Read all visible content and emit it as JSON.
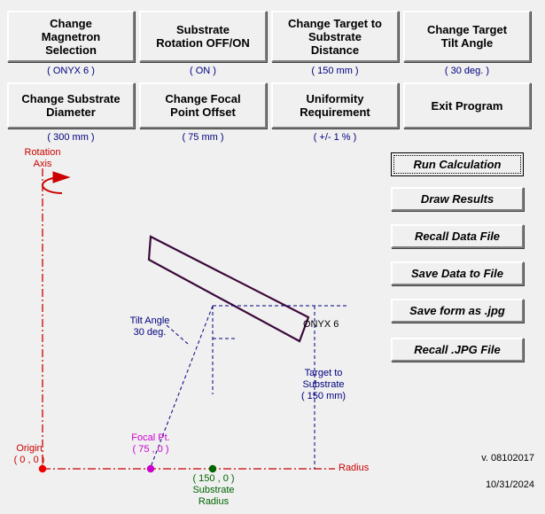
{
  "app": {
    "background_color": "#f0f0f0",
    "version_text": "v. 08102017",
    "date_text": "10/31/2024"
  },
  "setting_buttons": [
    {
      "label": "Change\nMagnetron\nSelection",
      "value": "( ONYX 6 )"
    },
    {
      "label": "Substrate\nRotation OFF/ON",
      "value": "( ON )"
    },
    {
      "label": "Change Target to\nSubstrate\nDistance",
      "value": "( 150 mm )"
    },
    {
      "label": "Change Target\nTilt Angle",
      "value": "( 30 deg. )"
    },
    {
      "label": "Change Substrate\nDiameter",
      "value": "( 300 mm )"
    },
    {
      "label": "Change Focal\nPoint Offset",
      "value": "( 75 mm )"
    },
    {
      "label": "Uniformity\nRequirement",
      "value": "( +/- 1 % )"
    },
    {
      "label": "Exit Program",
      "value": ""
    }
  ],
  "action_buttons": [
    {
      "label": "Run Calculation",
      "focused": true
    },
    {
      "label": "Draw Results",
      "focused": false
    },
    {
      "label": "Recall Data File",
      "focused": false
    },
    {
      "label": "Save Data to File",
      "focused": false
    },
    {
      "label": "Save form as .jpg",
      "focused": false
    },
    {
      "label": "Recall .JPG File",
      "focused": false
    }
  ],
  "diagram": {
    "rotation_axis_label": "Rotation\nAxis",
    "tilt_angle_label": "Tilt Angle\n30 deg.",
    "magnetron_label": "ONYX 6",
    "target_to_substrate_label": "Target to\nSubstrate\n( 150 mm)",
    "origin_label": "Origin\n( 0 , 0 )",
    "focal_point_label": "Focal Pt.\n( 75 , 0 )",
    "substrate_radius_label": "( 150 , 0 )\nSubstrate\nRadius",
    "radius_axis_label": "Radius",
    "colors": {
      "rotation_axis": "#cc0000",
      "origin_point": "#ee0000",
      "focal_point": "#cc00cc",
      "substrate_point": "#006400",
      "magnetron_outline": "#3b0a3b",
      "construction_lines": "#000080"
    }
  }
}
